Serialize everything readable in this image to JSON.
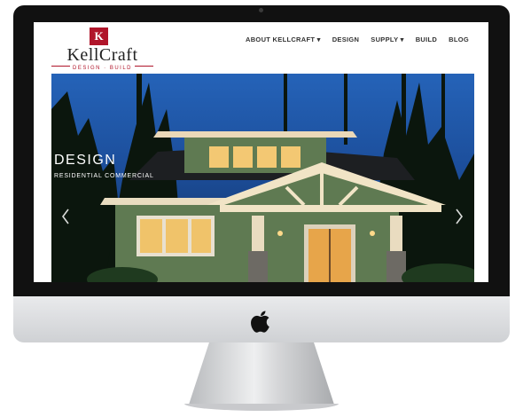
{
  "site": {
    "logo": {
      "badge": "K",
      "name": "KellCraft",
      "tagline": "DESIGN · BUILD"
    },
    "nav": [
      {
        "label": "ABOUT KELLCRAFT ▾"
      },
      {
        "label": "DESIGN"
      },
      {
        "label": "SUPPLY ▾"
      },
      {
        "label": "BUILD"
      },
      {
        "label": "BLOG"
      }
    ],
    "hero": {
      "title": "DESIGN",
      "subtitle": "RESIDENTIAL   COMMERCIAL",
      "prev_icon": "chevron-left-icon",
      "next_icon": "chevron-right-icon"
    }
  },
  "device": {
    "logo_icon": "apple-icon"
  },
  "colors": {
    "brand_red": "#b0152a",
    "sky": "#1c4e9b",
    "siding": "#5f7a52",
    "bezel": "#111111"
  }
}
